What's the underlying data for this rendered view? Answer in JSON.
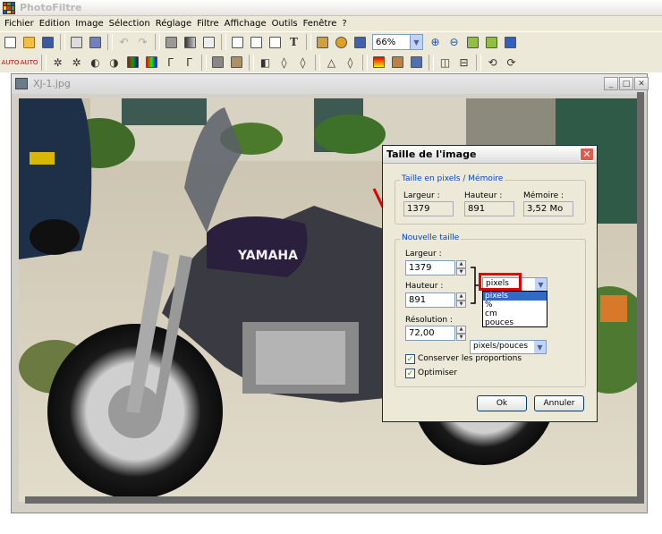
{
  "app": {
    "title": "PhotoFiltre"
  },
  "menu": [
    "Fichier",
    "Edition",
    "Image",
    "Sélection",
    "Réglage",
    "Filtre",
    "Affichage",
    "Outils",
    "Fenêtre",
    "?"
  ],
  "toolbar": {
    "zoom": "66%"
  },
  "document": {
    "title": "XJ-1.jpg"
  },
  "photo": {
    "brand_text": "YAMAHA"
  },
  "dialog": {
    "title": "Taille de l'image",
    "current_group": "Taille en pixels / Mémoire",
    "width_label": "Largeur :",
    "height_label": "Hauteur :",
    "memory_label": "Mémoire :",
    "current_width": "1379",
    "current_height": "891",
    "memory": "3,52 Mo",
    "new_group": "Nouvelle taille",
    "new_width_label": "Largeur :",
    "new_width": "1379",
    "new_height_label": "Hauteur :",
    "new_height": "891",
    "unit_selected": "pixels",
    "unit_options": [
      "pixels",
      "%",
      "cm",
      "pouces"
    ],
    "resolution_label": "Résolution :",
    "resolution": "72,00",
    "resolution_unit": "pixels/pouces",
    "keep_ratio": "Conserver les proportions",
    "optimize": "Optimiser",
    "ok": "Ok",
    "cancel": "Annuler"
  },
  "colors": {
    "highlight": "#e00000",
    "arrow": "#e00000",
    "selection": "#316ac5"
  }
}
